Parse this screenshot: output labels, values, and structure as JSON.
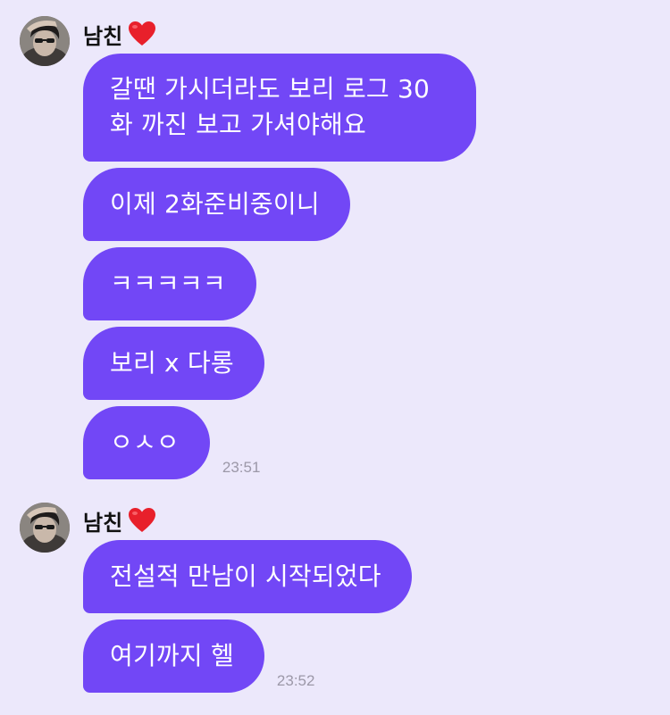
{
  "chat": {
    "groups": [
      {
        "sender": "남친",
        "sender_icon": "red-heart-icon",
        "messages": [
          {
            "text": "갈땐 가시더라도 보리 로그 30\n화 까진 보고 가셔야해요"
          },
          {
            "text": "이제 2화준비중이니"
          },
          {
            "text": "ㅋㅋㅋㅋㅋ"
          },
          {
            "text": "보리 x 다롱"
          },
          {
            "text": "ㅇㅅㅇ",
            "time": "23:51"
          }
        ]
      },
      {
        "sender": "남친",
        "sender_icon": "red-heart-icon",
        "messages": [
          {
            "text": "전설적 만남이 시작되었다"
          },
          {
            "text": "여기까지 헬",
            "time": "23:52"
          }
        ]
      }
    ]
  },
  "colors": {
    "background": "#ece8fb",
    "bubble": "#7247f6",
    "bubble_text": "#ffffff",
    "timestamp": "#9c98a8",
    "heart": "#e8202b"
  }
}
